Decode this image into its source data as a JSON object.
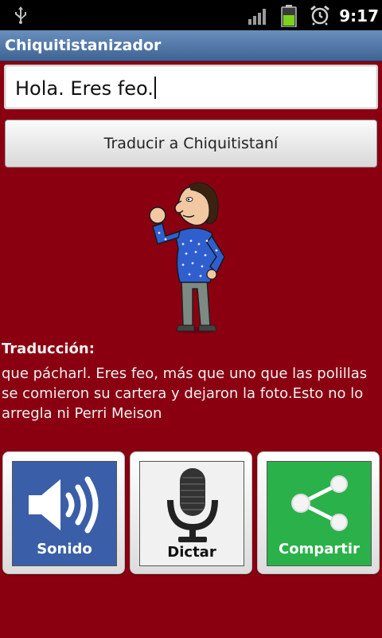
{
  "status_bar": {
    "time": "9:17",
    "icons": [
      "usb-icon",
      "signal-icon",
      "battery-icon",
      "alarm-icon"
    ]
  },
  "app": {
    "title": "Chiquitistanizador"
  },
  "input": {
    "value": "Hola. Eres feo."
  },
  "translate_button": {
    "label": "Traducir a Chiquitistaní"
  },
  "translation": {
    "label": "Traducción:",
    "text": "que pácharl. Eres  feo, más que uno que las polillas se comieron su cartera y dejaron la foto.Esto no lo arregla ni Perri Meison"
  },
  "actions": [
    {
      "label": "Sonido",
      "icon": "speaker-icon",
      "bg": "#3a5fa8"
    },
    {
      "label": "Dictar",
      "icon": "microphone-icon",
      "bg": "#f1f1f1"
    },
    {
      "label": "Compartir",
      "icon": "share-icon",
      "bg": "#2bb14a"
    }
  ],
  "colors": {
    "background": "#8a0011",
    "titlebar": "#4f76a8"
  }
}
